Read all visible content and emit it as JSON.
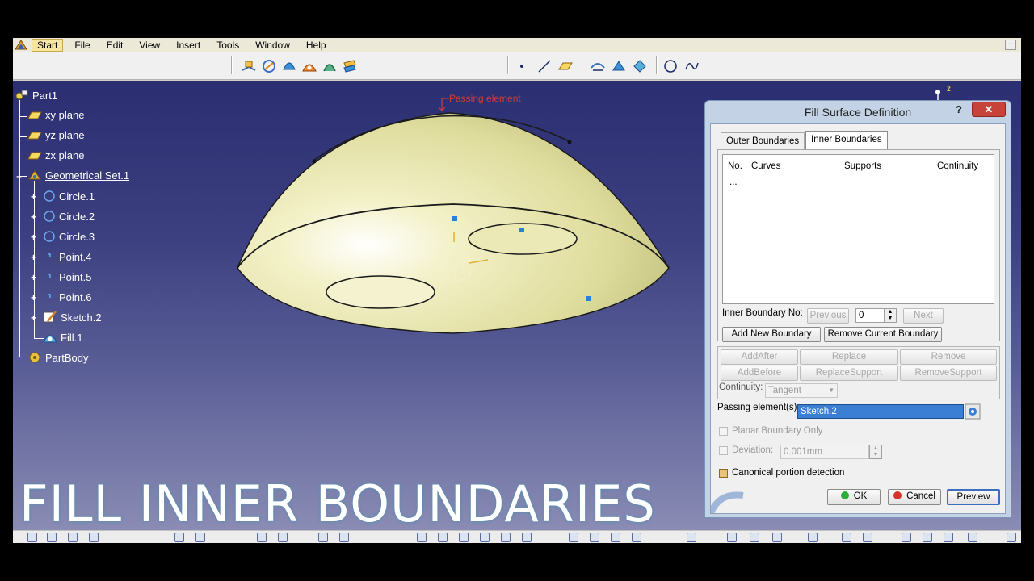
{
  "menu": {
    "items": [
      "Start",
      "File",
      "Edit",
      "View",
      "Insert",
      "Tools",
      "Window",
      "Help"
    ],
    "underline": [
      "S",
      "F",
      "E",
      "V",
      "I",
      "T",
      "W",
      "H"
    ],
    "minimize": "–"
  },
  "tree": {
    "nodes": [
      {
        "label": "Part1",
        "icon": "part-icon"
      },
      {
        "label": "xy plane",
        "icon": "plane-icon"
      },
      {
        "label": "yz plane",
        "icon": "plane-icon"
      },
      {
        "label": "zx plane",
        "icon": "plane-icon"
      },
      {
        "label": "Geometrical Set.1",
        "icon": "geometrical-set-icon"
      },
      {
        "label": "Circle.1",
        "icon": "circle-icon"
      },
      {
        "label": "Circle.2",
        "icon": "circle-icon"
      },
      {
        "label": "Circle.3",
        "icon": "circle-icon"
      },
      {
        "label": "Point.4",
        "icon": "point-icon"
      },
      {
        "label": "Point.5",
        "icon": "point-icon"
      },
      {
        "label": "Point.6",
        "icon": "point-icon"
      },
      {
        "label": "Sketch.2",
        "icon": "sketch-icon"
      },
      {
        "label": "Fill.1",
        "icon": "fill-icon"
      },
      {
        "label": "PartBody",
        "icon": "partbody-icon"
      }
    ]
  },
  "viewport": {
    "annotation": "Passing element",
    "axis_label": "z",
    "caption": "FILL INNER BOUNDARIES",
    "colors": {
      "surface": "#e6e4a8",
      "annotation": "#d23a3a",
      "point": "#2a7fd8"
    }
  },
  "dialog": {
    "title": "Fill Surface Definition",
    "help": "?",
    "close": "✕",
    "tabs": [
      "Outer Boundaries",
      "Inner Boundaries"
    ],
    "active_tab": "Inner Boundaries",
    "columns": [
      "No.",
      "Curves",
      "Supports",
      "Continuity"
    ],
    "rows_placeholder": "...",
    "inner_boundary_no_label": "Inner Boundary No:",
    "previous": "Previous",
    "inner_boundary_no_value": "0",
    "next": "Next",
    "add_new_boundary": "Add New Boundary",
    "remove_current_boundary": "Remove Current Boundary",
    "add_after": "AddAfter",
    "replace": "Replace",
    "remove": "Remove",
    "add_before": "AddBefore",
    "replace_support": "ReplaceSupport",
    "remove_support": "RemoveSupport",
    "continuity_label": "Continuity:",
    "continuity_value": "Tangent",
    "passing_elements_label": "Passing element(s):",
    "passing_elements_value": "Sketch.2",
    "planar_boundary_only": "Planar Boundary Only",
    "deviation_label": "Deviation:",
    "deviation_value": "0.001mm",
    "canonical_detection": "Canonical portion detection",
    "canonical_checked": true,
    "ok": "OK",
    "cancel": "Cancel",
    "preview": "Preview"
  }
}
